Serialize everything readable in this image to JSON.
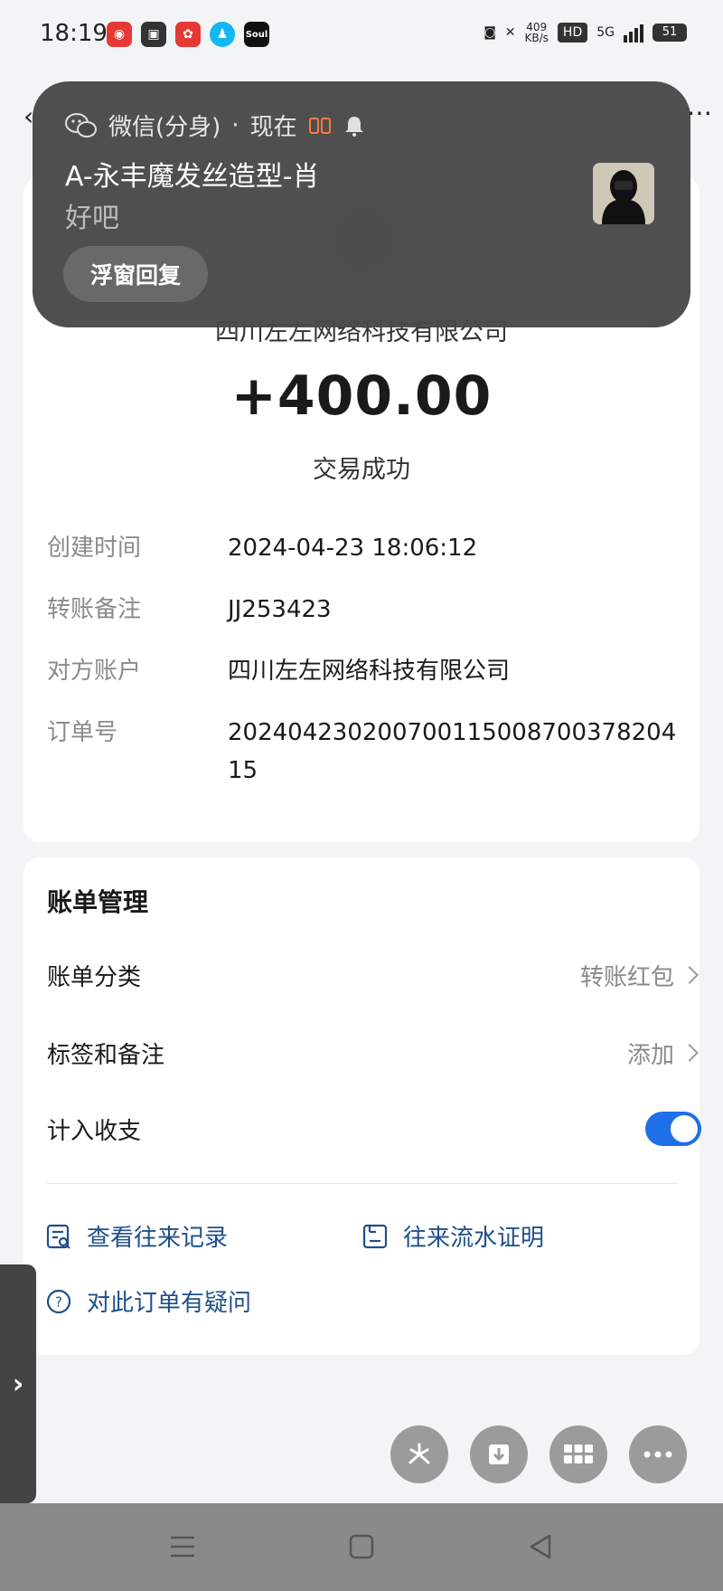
{
  "status_bar": {
    "time": "18:19",
    "apps": [
      {
        "icon": "netease-icon",
        "color": "#e53935"
      },
      {
        "icon": "gallery-icon",
        "color": "#333333"
      },
      {
        "icon": "xiaohongshu-icon",
        "color": "#e53935"
      },
      {
        "icon": "qq-icon",
        "color": "#12b7f5"
      },
      {
        "icon": "soul-icon",
        "color": "#111111",
        "label": "Soul"
      }
    ],
    "network_speed": "409",
    "network_unit": "KB/s",
    "network_type": "5G",
    "hd_label": "HD",
    "battery": "51"
  },
  "notification": {
    "app_label": "微信(分身)",
    "separator": "·",
    "time_label": "现在",
    "sender": "A-永丰魔发丝造型-肖",
    "message": "好吧",
    "reply_button": "浮窗回复"
  },
  "transaction": {
    "payee": "四川左左网络科技有限公司",
    "amount": "+400.00",
    "status": "交易成功",
    "details": [
      {
        "label": "创建时间",
        "value": "2024-04-23 18:06:12"
      },
      {
        "label": "转账备注",
        "value": "JJ253423"
      },
      {
        "label": "对方账户",
        "value": "四川左左网络科技有限公司"
      },
      {
        "label": "订单号",
        "value": "20240423020070011500870037820415"
      }
    ]
  },
  "bill_management": {
    "title": "账单管理",
    "category_label": "账单分类",
    "category_value": "转账红包",
    "tags_label": "标签和备注",
    "tags_value": "添加",
    "include_label": "计入收支",
    "include_enabled": true,
    "links": {
      "history": "查看往来记录",
      "statement": "往来流水证明",
      "question": "对此订单有疑问"
    }
  },
  "colors": {
    "accent": "#1e6fe8",
    "link": "#1f4f8a",
    "background": "#f3f4f6"
  }
}
